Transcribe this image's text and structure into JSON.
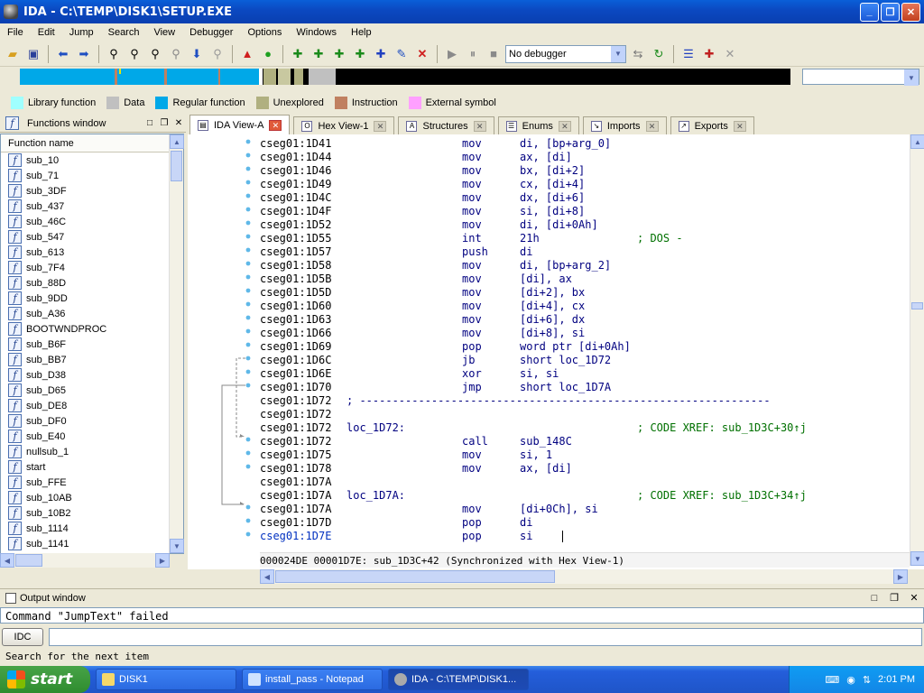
{
  "window": {
    "title": "IDA - C:\\TEMP\\DISK1\\SETUP.EXE",
    "minimize": "_",
    "maximize": "❐",
    "close": "✕"
  },
  "menu": [
    "File",
    "Edit",
    "Jump",
    "Search",
    "View",
    "Debugger",
    "Options",
    "Windows",
    "Help"
  ],
  "toolbar": {
    "debugger_select": "No debugger"
  },
  "legend": [
    {
      "label": "Library function",
      "color": "#a0ffff"
    },
    {
      "label": "Data",
      "color": "#c0c0c0"
    },
    {
      "label": "Regular function",
      "color": "#00a8e8"
    },
    {
      "label": "Unexplored",
      "color": "#b0b080"
    },
    {
      "label": "Instruction",
      "color": "#c08060"
    },
    {
      "label": "External symbol",
      "color": "#ffa0ff"
    }
  ],
  "functions_window": {
    "title": "Functions window",
    "column": "Function name",
    "items": [
      "sub_10",
      "sub_71",
      "sub_3DF",
      "sub_437",
      "sub_46C",
      "sub_547",
      "sub_613",
      "sub_7F4",
      "sub_88D",
      "sub_9DD",
      "sub_A36",
      "BOOTWNDPROC",
      "sub_B6F",
      "sub_BB7",
      "sub_D38",
      "sub_D65",
      "sub_DE8",
      "sub_DF0",
      "sub_E40",
      "nullsub_1",
      "start",
      "sub_FFE",
      "sub_10AB",
      "sub_10B2",
      "sub_1114",
      "sub_1141"
    ]
  },
  "tabs": [
    "IDA View-A",
    "Hex View-1",
    "Structures",
    "Enums",
    "Imports",
    "Exports"
  ],
  "disasm": [
    {
      "addr": "cseg01:1D41",
      "mn": "mov",
      "op": "di, [bp+arg_0]"
    },
    {
      "addr": "cseg01:1D44",
      "mn": "mov",
      "op": "ax, [di]"
    },
    {
      "addr": "cseg01:1D46",
      "mn": "mov",
      "op": "bx, [di+2]"
    },
    {
      "addr": "cseg01:1D49",
      "mn": "mov",
      "op": "cx, [di+4]"
    },
    {
      "addr": "cseg01:1D4C",
      "mn": "mov",
      "op": "dx, [di+6]"
    },
    {
      "addr": "cseg01:1D4F",
      "mn": "mov",
      "op": "si, [di+8]"
    },
    {
      "addr": "cseg01:1D52",
      "mn": "mov",
      "op": "di, [di+0Ah]"
    },
    {
      "addr": "cseg01:1D55",
      "mn": "int",
      "op": "21h",
      "cmt": "; DOS -"
    },
    {
      "addr": "cseg01:1D57",
      "mn": "push",
      "op": "di"
    },
    {
      "addr": "cseg01:1D58",
      "mn": "mov",
      "op": "di, [bp+arg_2]"
    },
    {
      "addr": "cseg01:1D5B",
      "mn": "mov",
      "op": "[di], ax"
    },
    {
      "addr": "cseg01:1D5D",
      "mn": "mov",
      "op": "[di+2], bx"
    },
    {
      "addr": "cseg01:1D60",
      "mn": "mov",
      "op": "[di+4], cx"
    },
    {
      "addr": "cseg01:1D63",
      "mn": "mov",
      "op": "[di+6], dx"
    },
    {
      "addr": "cseg01:1D66",
      "mn": "mov",
      "op": "[di+8], si"
    },
    {
      "addr": "cseg01:1D69",
      "mn": "pop",
      "op": "word ptr [di+0Ah]"
    },
    {
      "addr": "cseg01:1D6C",
      "mn": "jb",
      "op": "short loc_1D72"
    },
    {
      "addr": "cseg01:1D6E",
      "mn": "xor",
      "op": "si, si"
    },
    {
      "addr": "cseg01:1D70",
      "mn": "jmp",
      "op": "short loc_1D7A"
    },
    {
      "addr": "cseg01:1D72",
      "sep": "; ---------------------------------------------------------------"
    },
    {
      "addr": "cseg01:1D72"
    },
    {
      "addr": "cseg01:1D72",
      "label": "loc_1D72:",
      "cmt": "; CODE XREF: sub_1D3C+30↑j"
    },
    {
      "addr": "cseg01:1D72",
      "mn": "call",
      "op": "sub_148C"
    },
    {
      "addr": "cseg01:1D75",
      "mn": "mov",
      "op": "si, 1"
    },
    {
      "addr": "cseg01:1D78",
      "mn": "mov",
      "op": "ax, [di]"
    },
    {
      "addr": "cseg01:1D7A"
    },
    {
      "addr": "cseg01:1D7A",
      "label": "loc_1D7A:",
      "cmt": "; CODE XREF: sub_1D3C+34↑j"
    },
    {
      "addr": "cseg01:1D7A",
      "mn": "mov",
      "op": "[di+0Ch], si"
    },
    {
      "addr": "cseg01:1D7D",
      "mn": "pop",
      "op": "di"
    },
    {
      "addr": "cseg01:1D7E",
      "mn": "pop",
      "op": "si",
      "current": true
    }
  ],
  "disasm_status": "000024DE 00001D7E: sub_1D3C+42 (Synchronized with Hex View-1)",
  "output": {
    "title": "Output window",
    "text": "Command \"JumpText\" failed",
    "idc_button": "IDC",
    "hint": "Search for the next item"
  },
  "taskbar": {
    "start": "start",
    "tasks": [
      "DISK1",
      "install_pass - Notepad",
      "IDA - C:\\TEMP\\DISK1..."
    ],
    "clock": "2:01 PM"
  }
}
